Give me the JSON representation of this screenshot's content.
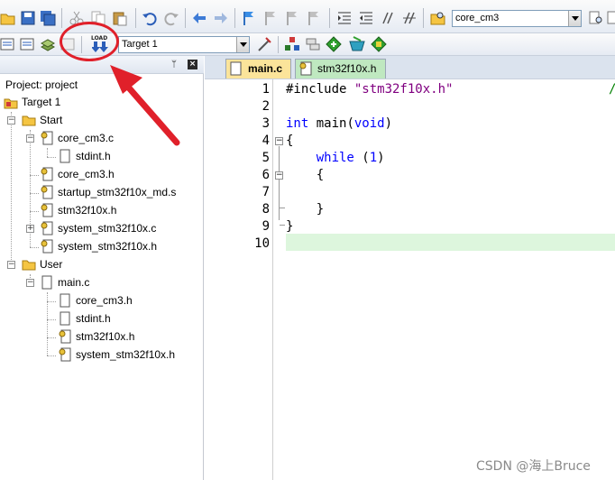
{
  "toolbar1": {
    "target_combo_value": "core_cm3",
    "icons": [
      "open-icon",
      "save-icon",
      "save-all-icon",
      "cut-icon",
      "copy-icon",
      "paste-icon",
      "undo-icon",
      "redo-icon",
      "back-icon",
      "forward-icon",
      "bookmark-icon",
      "prev-bookmark-icon",
      "next-bookmark-icon",
      "clear-bookmarks-icon",
      "indent-icon",
      "outdent-icon",
      "comment-icon",
      "uncomment-icon",
      "find-in-files-icon",
      "find-icon"
    ]
  },
  "toolbar2": {
    "target_select": "Target 1",
    "load_label": "LOAD"
  },
  "project": {
    "header": "Project: project",
    "target": "Target 1",
    "groups": [
      {
        "name": "Start",
        "files": [
          {
            "name": "core_cm3.c",
            "children": [
              {
                "name": "stdint.h"
              }
            ]
          },
          {
            "name": "core_cm3.h"
          },
          {
            "name": "startup_stm32f10x_md.s"
          },
          {
            "name": "stm32f10x.h"
          },
          {
            "name": "system_stm32f10x.c"
          },
          {
            "name": "system_stm32f10x.h"
          }
        ]
      },
      {
        "name": "User",
        "files": [
          {
            "name": "main.c",
            "children": [
              {
                "name": "core_cm3.h"
              },
              {
                "name": "stdint.h"
              },
              {
                "name": "stm32f10x.h"
              },
              {
                "name": "system_stm32f10x.h"
              }
            ]
          }
        ]
      }
    ]
  },
  "editor": {
    "tabs": [
      {
        "label": "main.c",
        "active": true
      },
      {
        "label": "stm32f10x.h",
        "active": false
      }
    ],
    "lines": [
      {
        "num": "1",
        "text": "#include \"stm32f10x.h\""
      },
      {
        "num": "2",
        "text": ""
      },
      {
        "num": "3",
        "text": "int main(void)"
      },
      {
        "num": "4",
        "text": "{"
      },
      {
        "num": "5",
        "text": "    while (1)"
      },
      {
        "num": "6",
        "text": "    {"
      },
      {
        "num": "7",
        "text": ""
      },
      {
        "num": "8",
        "text": "    }"
      },
      {
        "num": "9",
        "text": "}"
      },
      {
        "num": "10",
        "text": ""
      }
    ],
    "line1_tail": "/",
    "current_line": "10"
  },
  "watermark": "CSDN @海上Bruce",
  "colors": {
    "annotation": "#e0202a",
    "active_tab": "#fbe49a",
    "inactive_tab": "#bfe8c0",
    "current_line_bg": "#ddf6dd",
    "keyword": "#0000ff",
    "string": "#800080"
  }
}
